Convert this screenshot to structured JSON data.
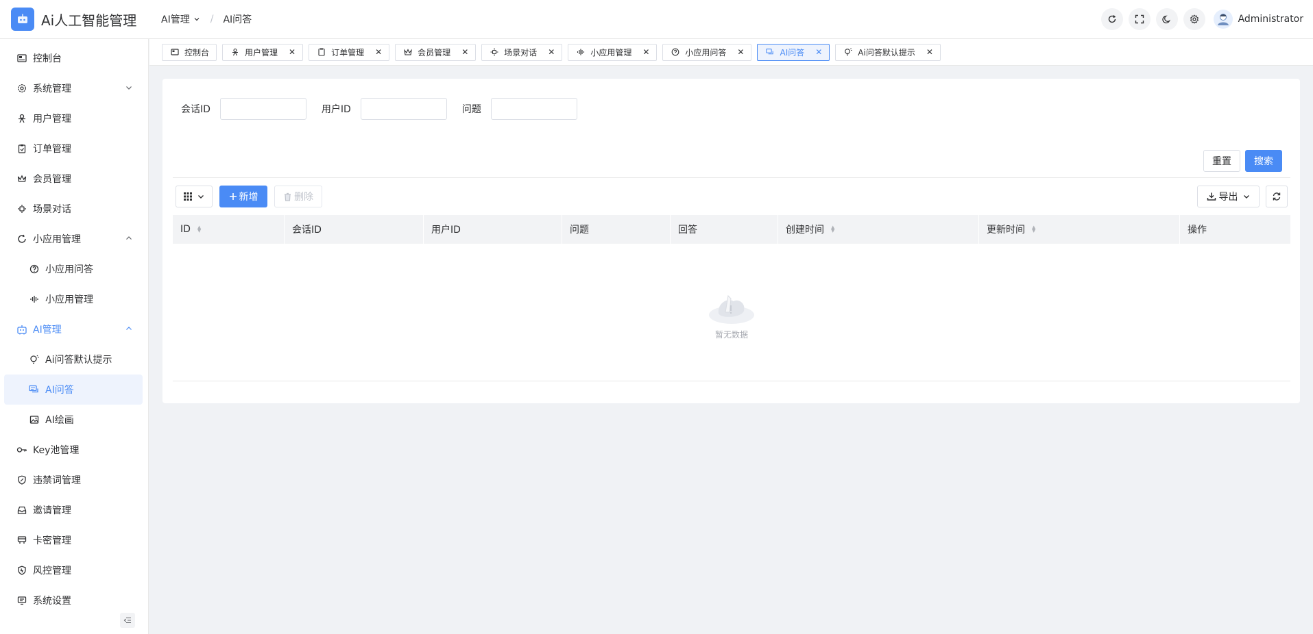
{
  "app": {
    "title": "Ai人工智能管理"
  },
  "breadcrumb": [
    {
      "label": "AI管理"
    },
    {
      "label": "AI问答"
    }
  ],
  "header": {
    "user_name": "Administrator"
  },
  "sidebar": {
    "items": [
      {
        "label": "控制台",
        "icon": "dashboard-icon"
      },
      {
        "label": "系统管理",
        "icon": "gear-icon"
      },
      {
        "label": "用户管理",
        "icon": "user-icon"
      },
      {
        "label": "订单管理",
        "icon": "clipboard-icon"
      },
      {
        "label": "会员管理",
        "icon": "crown-icon"
      },
      {
        "label": "场景对话",
        "icon": "scene-icon"
      },
      {
        "label": "小应用管理",
        "icon": "refresh-circle-icon"
      },
      {
        "label": "小应用问答",
        "icon": "question-circle-icon"
      },
      {
        "label": "小应用管理",
        "icon": "audio-wave-icon"
      },
      {
        "label": "AI管理",
        "icon": "robot-icon"
      },
      {
        "label": "Ai问答默认提示",
        "icon": "bulb-icon"
      },
      {
        "label": "AI问答",
        "icon": "chat-icon"
      },
      {
        "label": "AI绘画",
        "icon": "image-icon"
      },
      {
        "label": "Key池管理",
        "icon": "key-icon"
      },
      {
        "label": "违禁词管理",
        "icon": "shield-icon"
      },
      {
        "label": "邀请管理",
        "icon": "inbox-icon"
      },
      {
        "label": "卡密管理",
        "icon": "card-icon"
      },
      {
        "label": "风控管理",
        "icon": "shield-check-icon"
      },
      {
        "label": "系统设置",
        "icon": "settings-panel-icon"
      }
    ]
  },
  "tabs": [
    {
      "label": "控制台",
      "closable": false
    },
    {
      "label": "用户管理",
      "closable": true
    },
    {
      "label": "订单管理",
      "closable": true
    },
    {
      "label": "会员管理",
      "closable": true
    },
    {
      "label": "场景对话",
      "closable": true
    },
    {
      "label": "小应用管理",
      "closable": true
    },
    {
      "label": "小应用问答",
      "closable": true
    },
    {
      "label": "AI问答",
      "closable": true,
      "active": true
    },
    {
      "label": "Ai问答默认提示",
      "closable": true
    }
  ],
  "filters": {
    "session_id_label": "会话ID",
    "session_id_value": "",
    "user_id_label": "用户ID",
    "user_id_value": "",
    "question_label": "问题",
    "question_value": ""
  },
  "buttons": {
    "reset": "重置",
    "search": "搜索",
    "add": "新增",
    "delete": "删除",
    "export": "导出"
  },
  "table": {
    "columns": [
      "ID",
      "会话ID",
      "用户ID",
      "问题",
      "回答",
      "创建时间",
      "更新时间",
      "操作"
    ],
    "rows": [],
    "empty_text": "暂无数据"
  },
  "colors": {
    "primary": "#4a8bf5",
    "background": "#f0f2f5"
  }
}
